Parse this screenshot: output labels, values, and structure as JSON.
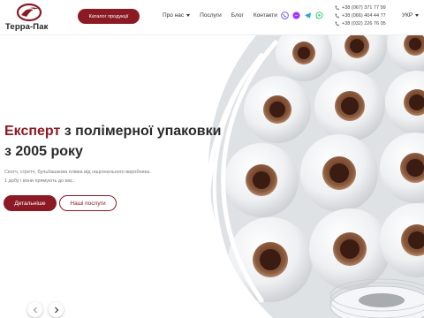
{
  "brand": {
    "name": "Терра-Пак",
    "accent": "#8b1a24"
  },
  "header": {
    "catalog_button": "Каталог продукції",
    "nav": [
      {
        "label": "Про нас",
        "has_dropdown": true
      },
      {
        "label": "Послуги",
        "has_dropdown": false
      },
      {
        "label": "Блог",
        "has_dropdown": false
      },
      {
        "label": "Контакти",
        "has_dropdown": false
      }
    ],
    "messengers": [
      {
        "icon": "viber-icon",
        "color": "#7360f2"
      },
      {
        "icon": "messenger-icon",
        "color": "#a033ff"
      },
      {
        "icon": "telegram-icon",
        "color": "#2aa3df"
      },
      {
        "icon": "whatsapp-icon",
        "color": "#25d366"
      }
    ],
    "phones": [
      {
        "icon": "phone-icon",
        "number": "+38 (067) 371 77 99"
      },
      {
        "icon": "phone-icon",
        "number": "+38 (066) 404 44 77"
      },
      {
        "icon": "phone-icon",
        "number": "+38 (032) 226 76 05"
      }
    ],
    "language": "УКР"
  },
  "hero": {
    "headline_accent": "Експерт",
    "headline_rest_line1": " з полімерної упаковки",
    "headline_line2": "з 2005 року",
    "description_line1": "Скотч, стретч, бульбашкова плівка від національного виробника.",
    "description_line2": "1 добу і вони прямують до вас.",
    "primary_button": "Детальніше",
    "secondary_button": "Наші послуги"
  },
  "slider": {
    "prev_icon": "chevron-left-icon",
    "next_icon": "chevron-right-icon"
  }
}
